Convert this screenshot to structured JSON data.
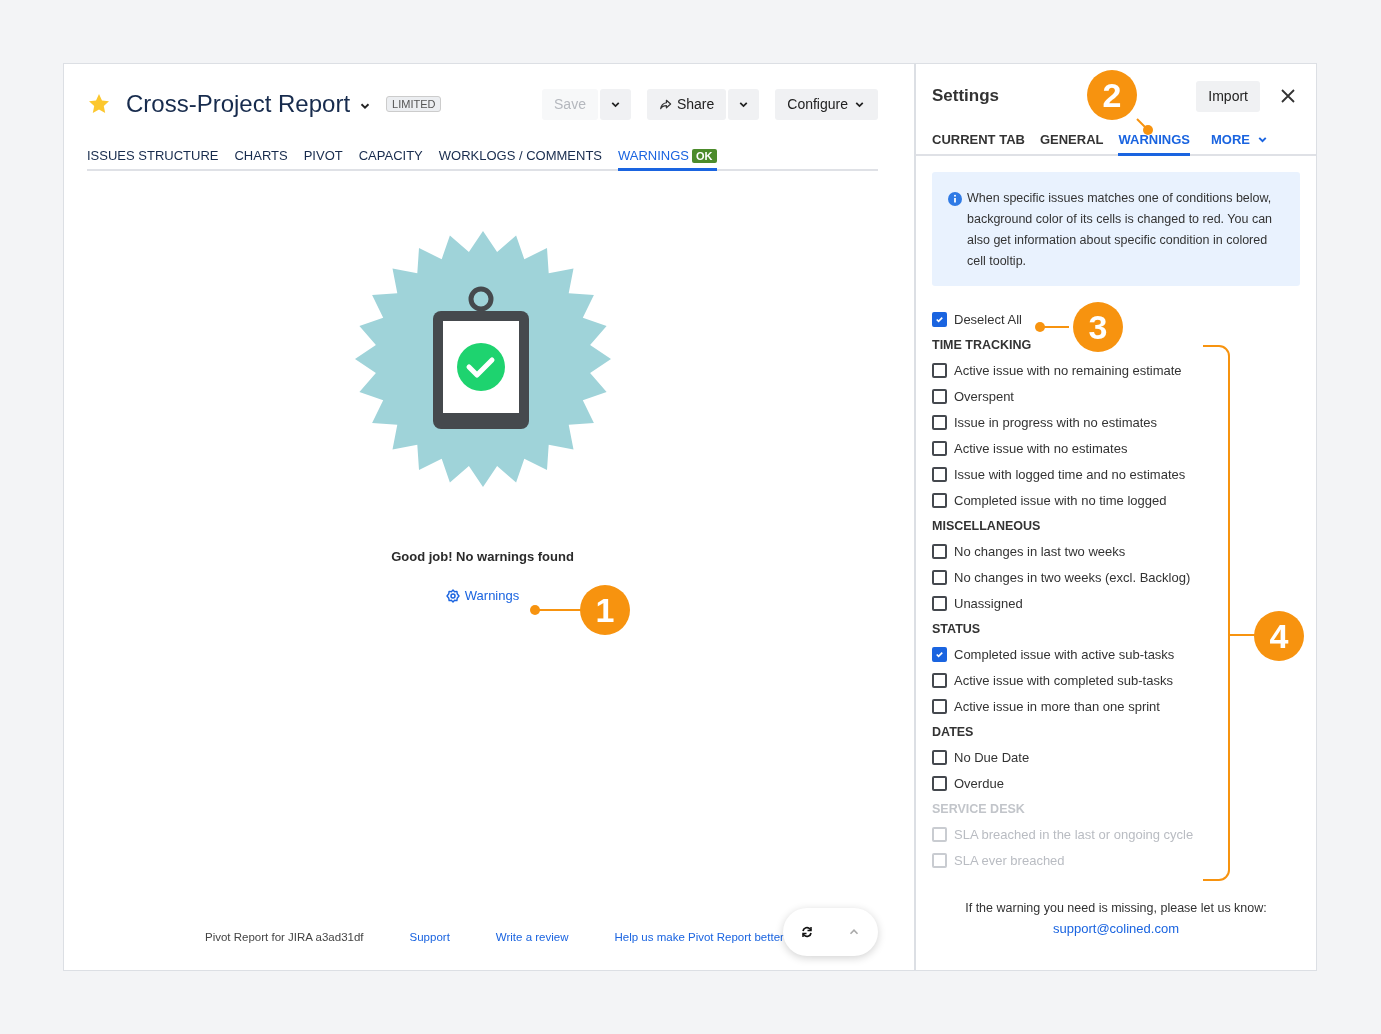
{
  "report": {
    "title": "Cross-Project Report",
    "badge": "LIMITED",
    "buttons": [
      {
        "kind": "split",
        "label": "Save",
        "disabled": true
      },
      {
        "kind": "split-share",
        "label": "Share",
        "disabled": false
      },
      {
        "kind": "menu",
        "label": "Configure",
        "disabled": false
      }
    ],
    "tabs": [
      {
        "label": "ISSUES STRUCTURE",
        "selected": false
      },
      {
        "label": "CHARTS",
        "selected": false
      },
      {
        "label": "PIVOT",
        "selected": false
      },
      {
        "label": "CAPACITY",
        "selected": false
      },
      {
        "label": "WORKLOGS / COMMENTS",
        "selected": false
      },
      {
        "label": "WARNINGS",
        "selected": true,
        "badge": "OK"
      }
    ]
  },
  "empty_state": {
    "message": "Good job! No warnings found",
    "link": "Warnings"
  },
  "footer": {
    "version": "Pivot Report for JIRA a3ad31df",
    "links": [
      "Support",
      "Write a review",
      "Help us make Pivot Report better"
    ]
  },
  "settings": {
    "title": "Settings",
    "import": "Import",
    "tabs": [
      {
        "label": "CURRENT TAB",
        "selected": false,
        "kind": "tab"
      },
      {
        "label": "GENERAL",
        "selected": false,
        "kind": "tab"
      },
      {
        "label": "WARNINGS",
        "selected": true,
        "kind": "tab"
      },
      {
        "label": "MORE",
        "selected": false,
        "kind": "dropdown"
      }
    ],
    "info": "When specific issues matches one of conditions below, background color of its cells is changed to red. You can also get information about specific condition in colored cell tooltip.",
    "deselect_all": {
      "label": "Deselect All",
      "checked": true
    },
    "groups": [
      {
        "title": "TIME TRACKING",
        "disabled": false,
        "items": [
          {
            "label": "Active issue with no remaining estimate",
            "checked": false,
            "disabled": false
          },
          {
            "label": "Overspent",
            "checked": false,
            "disabled": false
          },
          {
            "label": "Issue in progress with no estimates",
            "checked": false,
            "disabled": false
          },
          {
            "label": "Active issue with no estimates",
            "checked": false,
            "disabled": false
          },
          {
            "label": "Issue with logged time and no estimates",
            "checked": false,
            "disabled": false
          },
          {
            "label": "Completed issue with no time logged",
            "checked": false,
            "disabled": false
          }
        ]
      },
      {
        "title": "MISCELLANEOUS",
        "disabled": false,
        "items": [
          {
            "label": "No changes in last two weeks",
            "checked": false,
            "disabled": false
          },
          {
            "label": "No changes in two weeks (excl. Backlog)",
            "checked": false,
            "disabled": false
          },
          {
            "label": "Unassigned",
            "checked": false,
            "disabled": false
          }
        ]
      },
      {
        "title": "STATUS",
        "disabled": false,
        "items": [
          {
            "label": "Completed issue with active sub-tasks",
            "checked": true,
            "disabled": false
          },
          {
            "label": "Active issue with completed sub-tasks",
            "checked": false,
            "disabled": false
          },
          {
            "label": "Active issue in more than one sprint",
            "checked": false,
            "disabled": false
          }
        ]
      },
      {
        "title": "DATES",
        "disabled": false,
        "items": [
          {
            "label": "No Due Date",
            "checked": false,
            "disabled": false
          },
          {
            "label": "Overdue",
            "checked": false,
            "disabled": false
          }
        ]
      },
      {
        "title": "SERVICE DESK",
        "disabled": true,
        "items": [
          {
            "label": "SLA breached in the last or ongoing cycle",
            "checked": false,
            "disabled": true
          },
          {
            "label": "SLA ever breached",
            "checked": false,
            "disabled": true
          }
        ]
      }
    ],
    "missing_note": "If the warning you need is missing, please let us know:",
    "email": "support@colined.com"
  },
  "callouts": [
    "1",
    "2",
    "3",
    "4"
  ]
}
